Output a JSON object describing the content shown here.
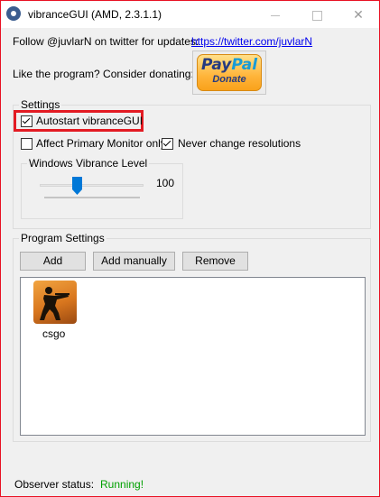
{
  "window": {
    "title": "vibranceGUI (AMD, 2.3.1.1)",
    "accent_border_color": "#e81123"
  },
  "header": {
    "follow_text": "Follow @juvlarN on twitter for updates:",
    "twitter_link": "https://twitter.com/juvlarN",
    "donate_text": "Like the program? Consider donating:",
    "paypal_pay": "Pay",
    "paypal_pal": "Pal",
    "paypal_donate": "Donate"
  },
  "settings": {
    "title": "Settings",
    "autostart": {
      "label": "Autostart vibranceGUI",
      "checked": true
    },
    "affect_primary": {
      "label": "Affect Primary Monitor only",
      "checked": false
    },
    "never_change_res": {
      "label": "Never change resolutions",
      "checked": true
    },
    "vibrance_group_title": "Windows Vibrance Level",
    "vibrance_value": "100",
    "vibrance_level_fraction": 0.3
  },
  "program_settings": {
    "title": "Program Settings",
    "add_label": "Add",
    "add_manually_label": "Add manually",
    "remove_label": "Remove",
    "programs": [
      {
        "name": "csgo",
        "icon": "csgo-icon"
      }
    ]
  },
  "status": {
    "label": "Observer status:",
    "value": "Running!",
    "value_color": "#00a000"
  }
}
